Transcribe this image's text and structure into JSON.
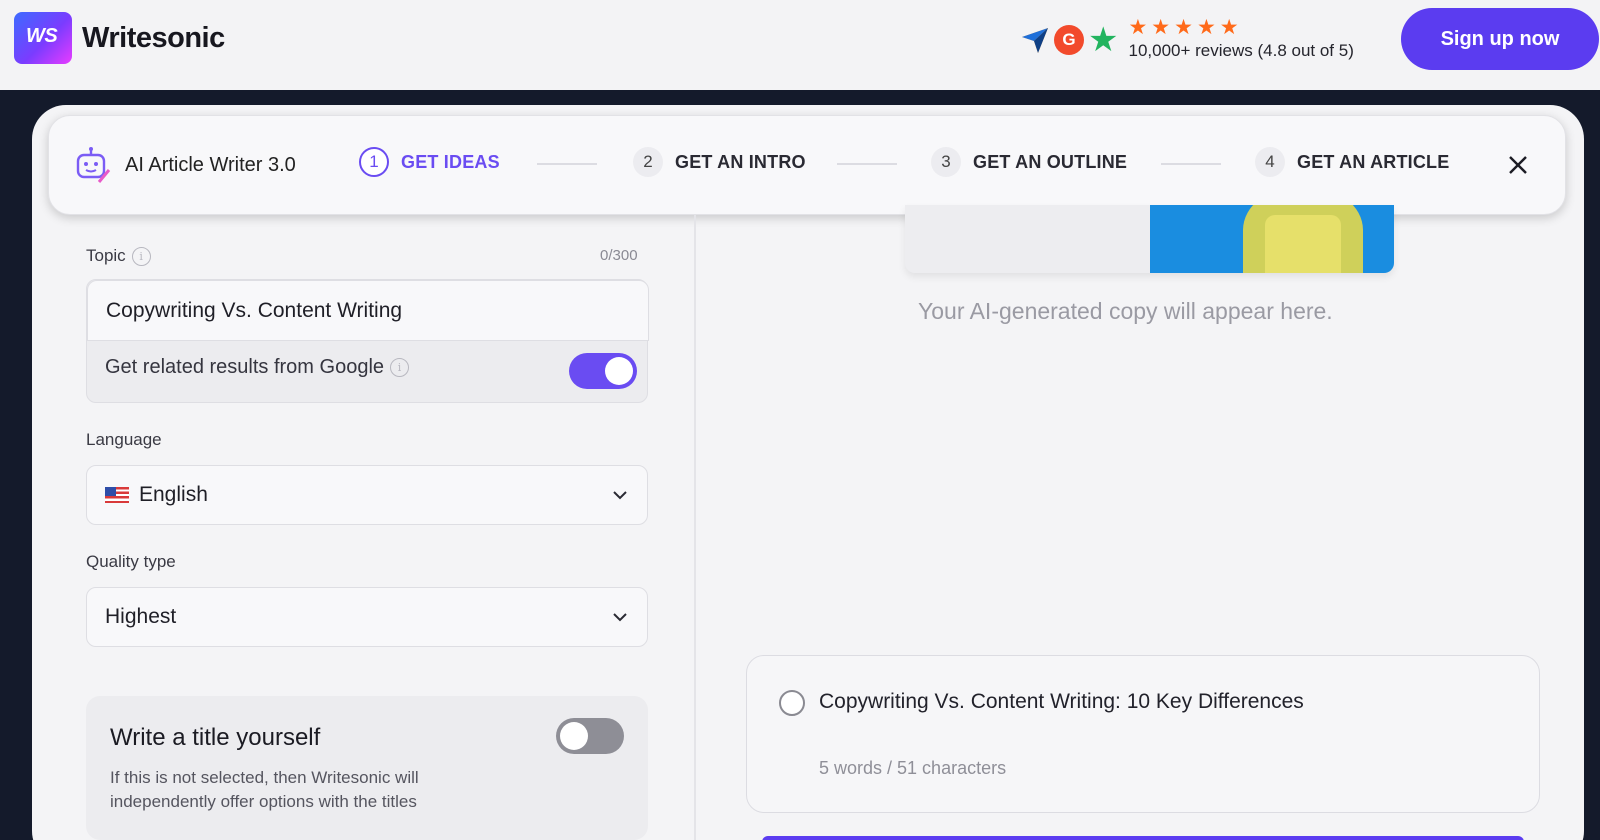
{
  "header": {
    "logo_mark": "WS",
    "logo_text": "Writesonic",
    "rating_stars": "★★★★★",
    "reviews_text": "10,000+ reviews (4.8 out of 5)",
    "g2_badge": "G",
    "signup_label": "Sign up now"
  },
  "stepper": {
    "tool_title": "AI Article Writer 3.0",
    "steps": [
      {
        "num": "1",
        "label": "GET IDEAS"
      },
      {
        "num": "2",
        "label": "GET AN INTRO"
      },
      {
        "num": "3",
        "label": "GET AN OUTLINE"
      },
      {
        "num": "4",
        "label": "GET AN ARTICLE"
      }
    ],
    "active_step": 1
  },
  "form": {
    "topic_label": "Topic",
    "topic_counter": "0/300",
    "topic_value": "Copywriting Vs. Content Writing",
    "google_label": "Get related results from Google",
    "google_enabled": true,
    "language_label": "Language",
    "language_value": "English",
    "quality_label": "Quality type",
    "quality_value": "Highest",
    "own_title_heading": "Write a title yourself",
    "own_title_desc": "If this is not selected, then Writesonic will independently offer options with the titles",
    "own_title_enabled": false
  },
  "output": {
    "placeholder": "Your AI-generated copy will appear here.",
    "results": [
      {
        "title": "Copywriting Vs. Content Writing: 10 Key Differences",
        "meta": "5 words / 51 characters"
      }
    ]
  },
  "colors": {
    "accent": "#6a4cf2",
    "signup": "#5b3cf0",
    "frame": "#141a2b"
  }
}
